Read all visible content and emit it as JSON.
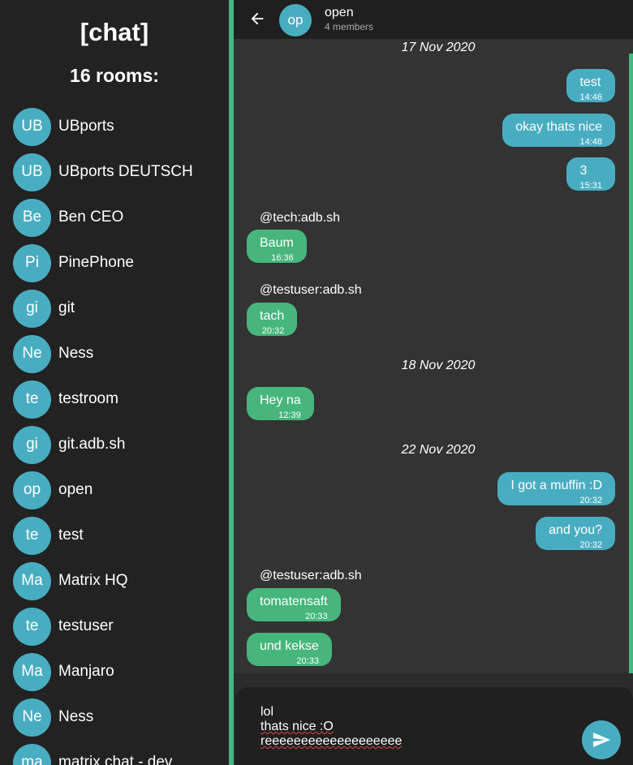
{
  "sidebar": {
    "app_title": "[chat]",
    "rooms_count": "16 rooms:",
    "rooms": [
      {
        "initials": "UB",
        "name": "UBports"
      },
      {
        "initials": "UB",
        "name": "UBports DEUTSCH"
      },
      {
        "initials": "Be",
        "name": "Ben CEO"
      },
      {
        "initials": "Pi",
        "name": "PinePhone"
      },
      {
        "initials": "gi",
        "name": "git"
      },
      {
        "initials": "Ne",
        "name": "Ness"
      },
      {
        "initials": "te",
        "name": "testroom"
      },
      {
        "initials": "gi",
        "name": "git.adb.sh"
      },
      {
        "initials": "op",
        "name": "open"
      },
      {
        "initials": "te",
        "name": "test"
      },
      {
        "initials": "Ma",
        "name": "Matrix HQ"
      },
      {
        "initials": "te",
        "name": "testuser"
      },
      {
        "initials": "Ma",
        "name": "Manjaro"
      },
      {
        "initials": "Ne",
        "name": "Ness"
      },
      {
        "initials": "ma",
        "name": "matrix chat - dev"
      }
    ]
  },
  "header": {
    "avatar_initials": "op",
    "title": "open",
    "subtitle": "4 members"
  },
  "chat": {
    "dates": [
      "17 Nov 2020",
      "18 Nov 2020",
      "22 Nov 2020"
    ],
    "senders": [
      "@tech:adb.sh",
      "@testuser:adb.sh",
      "@testuser:adb.sh"
    ],
    "messages": [
      {
        "text": "test",
        "time": "14:46"
      },
      {
        "text": "okay thats nice",
        "time": "14:48"
      },
      {
        "text": "3",
        "time": "15:31"
      },
      {
        "text": "Baum",
        "time": "16:36"
      },
      {
        "text": "tach",
        "time": "20:32"
      },
      {
        "text": "Hey na",
        "time": "12:39"
      },
      {
        "text": "I got a muffin :D",
        "time": "20:32"
      },
      {
        "text": "and you?",
        "time": "20:32"
      },
      {
        "text": "tomatensaft",
        "time": "20:33"
      },
      {
        "text": "und kekse",
        "time": "20:33"
      }
    ]
  },
  "composer": {
    "lines": [
      "lol",
      "thats nice :O",
      "reeeeeeeeeeeeeeeeeee"
    ]
  },
  "colors": {
    "accent_blue": "#49adc1",
    "accent_green": "#46b67c",
    "sidebar_bg": "#222222",
    "chat_bg": "#333333"
  },
  "icons": {
    "back": "arrow-left-icon",
    "send": "send-icon"
  }
}
